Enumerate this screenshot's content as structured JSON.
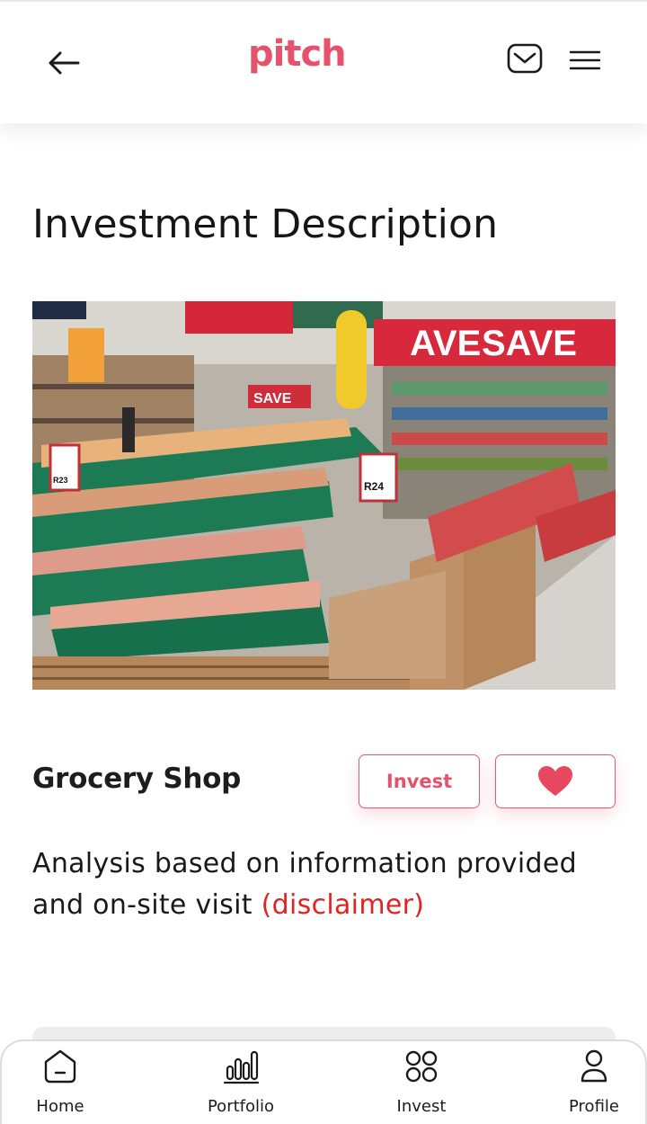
{
  "header": {
    "logo_text": "pitch",
    "brand_color": "#e5536b",
    "back_icon": "arrow-left-icon",
    "mail_icon": "mail-icon",
    "menu_icon": "hamburger-menu-icon"
  },
  "page": {
    "title": "Investment Description"
  },
  "listing": {
    "image_alt": "grocery store fruit displays",
    "name": "Grocery Shop",
    "invest_label": "Invest",
    "favorite_icon": "heart-icon",
    "analysis_text": "Analysis based on information provided and on-site visit ",
    "disclaimer_label": "(disclaimer)",
    "disclaimer_color": "#e02424"
  },
  "bottom_nav": {
    "items": [
      {
        "label": "Home",
        "icon": "home-icon"
      },
      {
        "label": "Portfolio",
        "icon": "bar-chart-icon"
      },
      {
        "label": "Invest",
        "icon": "grid-circles-icon"
      },
      {
        "label": "Profile",
        "icon": "user-icon"
      }
    ]
  }
}
